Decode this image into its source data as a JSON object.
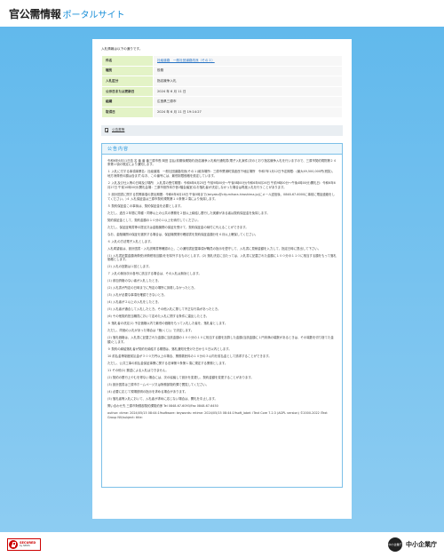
{
  "header": {
    "logo_main": "官公需情報",
    "logo_sub": "ポータルサイト"
  },
  "intro": "入札情報は以下の通りです。",
  "info_rows": [
    {
      "label": "件名",
      "value": "社級道路　一般社団道路改良（その１）",
      "is_link": true
    },
    {
      "label": "種別",
      "value": "役務",
      "is_link": false
    },
    {
      "label": "入札区分",
      "value": "指名競争入札",
      "is_link": false
    },
    {
      "label": "公示日または更新日",
      "value": "2024 年 6 月 11 日",
      "is_link": false
    },
    {
      "label": "組織",
      "value": "広島県三原市",
      "is_link": false
    },
    {
      "label": "取得日",
      "value": "2024 年 6 月 11 日 19:14:27",
      "is_link": false
    }
  ],
  "source_link": "公告書等",
  "content_title": "公告内容",
  "paragraphs": [
    "令和6年6月11日告 名 番 番 番三原市長 岡田 吉弘(前期後期契約)指名競争入札執行通知書(電子入札案件)次のとおり指名競争入札を行いますので、三原市契約規則第２４条第２項の規定により通知します。",
    "１ 入札に付する事項事業名：社級道路　一般社団道路改良(その１)維持場所：三原市鷺浦町須波西下地区場所　令和7年1月12日予定期限：(最大49,500,000円(税抜)、地方消費税の額は含まず)なお、この番号には、最低制限価格を設定しています。",
    "２ 入札及び仕入等の日時及び場所　入札書の受付期間：令和6年6月25日 午前9時00分～午後5時00分(令和6年6月26日 午前9時00分～午後4時00分)開札日：令和6年6月27日 午前10時00分(開札会場：三原市役所本庁舎2階会議室)なお落札者が決定しなかった場合は再度入札を行うことがあります。",
    "３ 設計図書に関する質問事項の提出期間：令和6年6月18日 午後5時まで(keiyaku@city.mihara.hiroshima.jp)にメール送信後、0848-67-6000に事前に電話連絡をしてください。)４ 入札保証金は三原市契約規則第１４条第２項により免除します。",
    "５ 契約保証金この事後は、契約保証金を必要とします。",
    "ただし、過去２年間に同種・同等以上の公共の業務を２回以上締結し履行した実績がある者は契約保証金を免除します。",
    "契約保証金として、契約金額の１０分の１以上を納付してください。",
    "ただし、保証証明書等の提出又は金融機関の保証を受けて、契約保証金の納付に代えることができます。",
    "なお、金融機関の保証を選択する場合は、保証機関発行確認書を契約保証金額分を６月以上確保してください。",
    "６ 入札の方法電子入札とします。",
    "入札希望者は、設計図書・入札説明書等確認の上、この通知書記載事項が職員の指示を遵守して、入札書に見積金額を入力して、指定日時に提出して下さい。",
    "(1) 入札書記載金額消費税(消費税相当額)をを除外するものとします。(2) 落札決定に当たっては、入札書に記載された金額に１００分の１１０に相当する額をもって落札価格とします。",
    "(2) 入札の回数は１回とします。",
    "７ 入札の無効次の各号に該当する場合は、その入札は無効とします。",
    "(1) 参加資格のない者が入札したとき。",
    "(2) 入札書が所定の日時までに所定の場所に到着しなかったとき。",
    "(3) 入札が必要な事項を確認できないとき。",
    "(4) 入札者が２以上の入札をしたとき。",
    "(5) 入札者が通合して入札したとき。その他入札に際して不正な行為があったとき。",
    "(6) その他契約担当職員において定めた入札に関する条件に違反したとき。",
    "８ 落札者の決定(1) 予定価格以内で最低の価格をもって入札した者を、落札者とします。",
    "ただし、同価の入札があった場合は「籤(くじ)」で決定します。",
    "(2) 落札価格は、入札書に記載された金額に当該金額の１００分の１０に相当する額を加算した金額(当該金額に１円未満の端数があるときは、その端数を切り捨てた金額)とします。",
    "９ 契約の締結落札者が契約を締結する期間は、落札通知を受けた日から５日以内とします。",
    "10 前払金等制度前払金が３００万円以上の場合、業務委託料の１０分の３以内を前払金として請求することができます。",
    "ただし、公共工事の前払金保証事業に関する法律第５条第１項に規定する業務とします。",
    "11 その他(1) 郵送による入札はできません。",
    "(2) 契約の履行上やむを得ない場合には、次の協議して設計を変更し、契約金額を変更することがあります。",
    "(3) 設計図書は三原市ホームページ又は財務部契約課で閲覧してください。",
    "(4) 必要に応じて現場説明の指示を求める場合があります。",
    "(5) 落札者等入札において、入札者が求めに応じない場合は、開札を中止します。",
    "問い合わせ先 三原市財務部契約課契約係 Tel 0848-67-6093/Fax 0848-67-6450",
    "author: ctime: 2024/05/15 08:44:19software: keywords: mtime: 2024/05/15 08:44:19soft_label: iText Core 7.2.3 (AGPL version) ©2000-2022 iText Group NV/subject: title:"
  ],
  "footer": {
    "secured_title": "SECURED",
    "secured_sub": "by SPIDS",
    "brand_circle": "中小企業庁",
    "brand_text": "中小企業庁"
  },
  "colors": {
    "background_top": "#5fb8ec",
    "accent": "#1a8fd8",
    "table_header": "#e3f3c6",
    "link": "#2a75c5"
  }
}
